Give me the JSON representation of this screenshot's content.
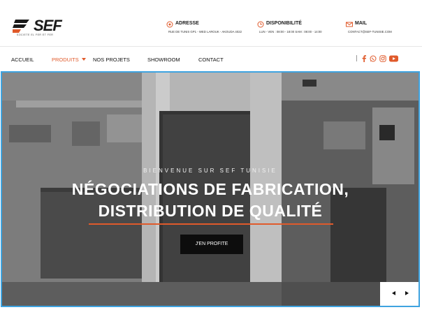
{
  "header": {
    "logo_text": "SEF",
    "logo_tagline": "SOCIETE EL FER ET FER",
    "info": [
      {
        "title": "ADRESSE",
        "sub": "RUE DE TUNIS GP1 - WED LAROUK - AKOUDA 4022",
        "icon": "location-icon"
      },
      {
        "title": "DISPONIBILITÉ",
        "sub": "LUN - VEN : 08:00 - 18:00  SAM : 08:00 - 14:00",
        "icon": "clock-icon"
      },
      {
        "title": "MAIL",
        "sub": "CONTACT@SEF-TUNISIE.COM",
        "icon": "mail-icon"
      }
    ]
  },
  "nav": {
    "items": [
      "ACCUEIL",
      "PRODUITS",
      "NOS PROJETS",
      "SHOWROOM",
      "CONTACT"
    ],
    "active": "PRODUITS",
    "social_icons": [
      "facebook-icon",
      "whatsapp-icon",
      "instagram-icon",
      "youtube-icon"
    ]
  },
  "hero": {
    "eyebrow": "BIENVENUE SUR SEF TUNISIE",
    "title_line1": "NÉGOCIATIONS DE FABRICATION,",
    "title_line2": "DISTRIBUTION DE QUALITÉ",
    "cta": "J'EN PROFITE"
  },
  "colors": {
    "accent": "#e05a2b",
    "hero_border": "#3ea3e0",
    "button": "#0d0d0d"
  }
}
